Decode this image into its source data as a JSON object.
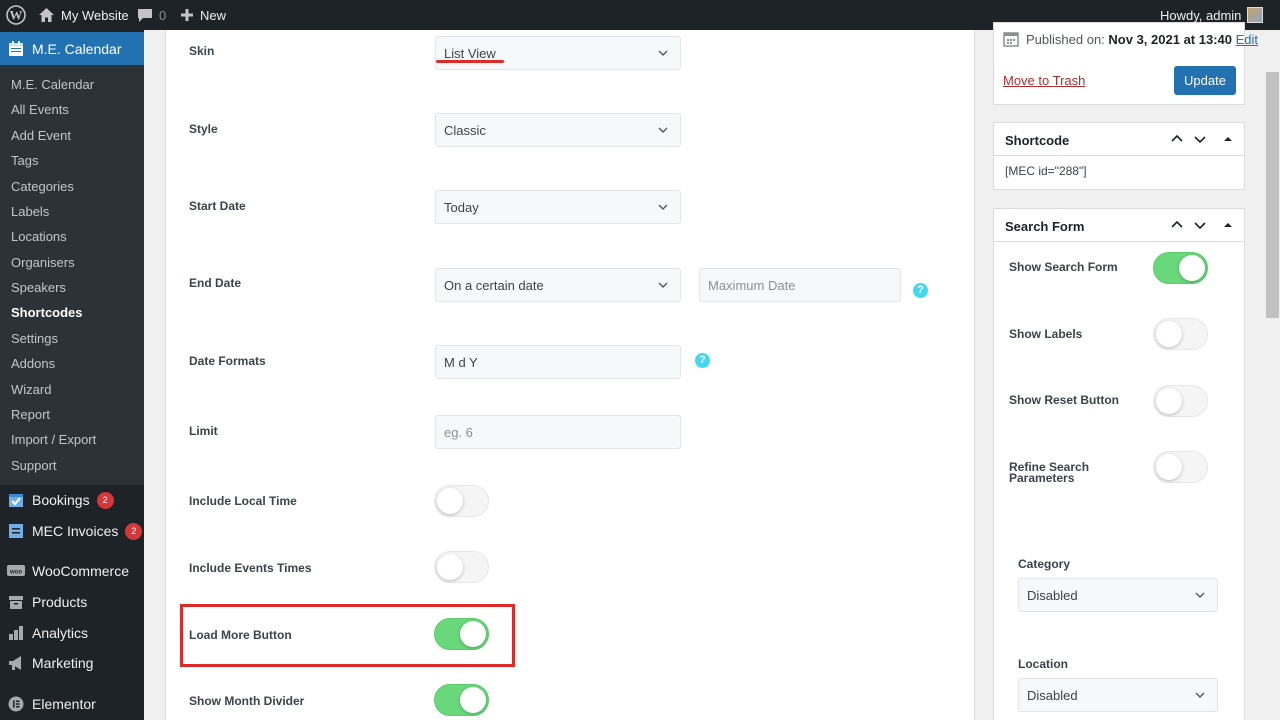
{
  "adminbar": {
    "site_name": "My Website",
    "comments_count": "0",
    "new_label": "New",
    "howdy": "Howdy, admin"
  },
  "sidebar": {
    "current_menu": "M.E. Calendar",
    "submenu": [
      "M.E. Calendar",
      "All Events",
      "Add Event",
      "Tags",
      "Categories",
      "Labels",
      "Locations",
      "Organisers",
      "Speakers",
      "Shortcodes",
      "Settings",
      "Addons",
      "Wizard",
      "Report",
      "Import / Export",
      "Support"
    ],
    "menu": {
      "bookings": "Bookings",
      "bookings_badge": "2",
      "invoices": "MEC Invoices",
      "invoices_badge": "2",
      "woocommerce": "WooCommerce",
      "products": "Products",
      "analytics": "Analytics",
      "marketing": "Marketing",
      "elementor": "Elementor"
    }
  },
  "form": {
    "skin_label": "Skin",
    "skin_value": "List View",
    "style_label": "Style",
    "style_value": "Classic",
    "start_date_label": "Start Date",
    "start_date_value": "Today",
    "end_date_label": "End Date",
    "end_date_value": "On a certain date",
    "end_date_max_placeholder": "Maximum Date",
    "date_formats_label": "Date Formats",
    "date_formats_value": "M d Y",
    "limit_label": "Limit",
    "limit_placeholder": "eg. 6",
    "include_local_time_label": "Include Local Time",
    "include_local_time_on": false,
    "include_events_times_label": "Include Events Times",
    "include_events_times_on": false,
    "load_more_label": "Load More Button",
    "load_more_on": true,
    "month_divider_label": "Show Month Divider",
    "month_divider_on": true,
    "help_glyph": "?"
  },
  "publish": {
    "published_prefix": "Published on:",
    "published_date": "Nov 3, 2021 at 13:40",
    "edit_link": "Edit",
    "trash_link": "Move to Trash",
    "update_button": "Update"
  },
  "shortcode_box": {
    "title": "Shortcode",
    "value": "[MEC id=\"288\"]"
  },
  "search_form_box": {
    "title": "Search Form",
    "show_search_form": "Show Search Form",
    "show_search_form_on": true,
    "show_labels": "Show Labels",
    "show_labels_on": false,
    "show_reset": "Show Reset Button",
    "show_reset_on": false,
    "refine_line1": "Refine Search",
    "refine_line2": "Parameters",
    "refine_on": false,
    "category_label": "Category",
    "category_value": "Disabled",
    "location_label": "Location",
    "location_value": "Disabled"
  },
  "colors": {
    "accent": "#2271b1",
    "toggle_on": "#68d87a",
    "highlight_red": "#e02a2a",
    "help": "#40d9f1"
  }
}
